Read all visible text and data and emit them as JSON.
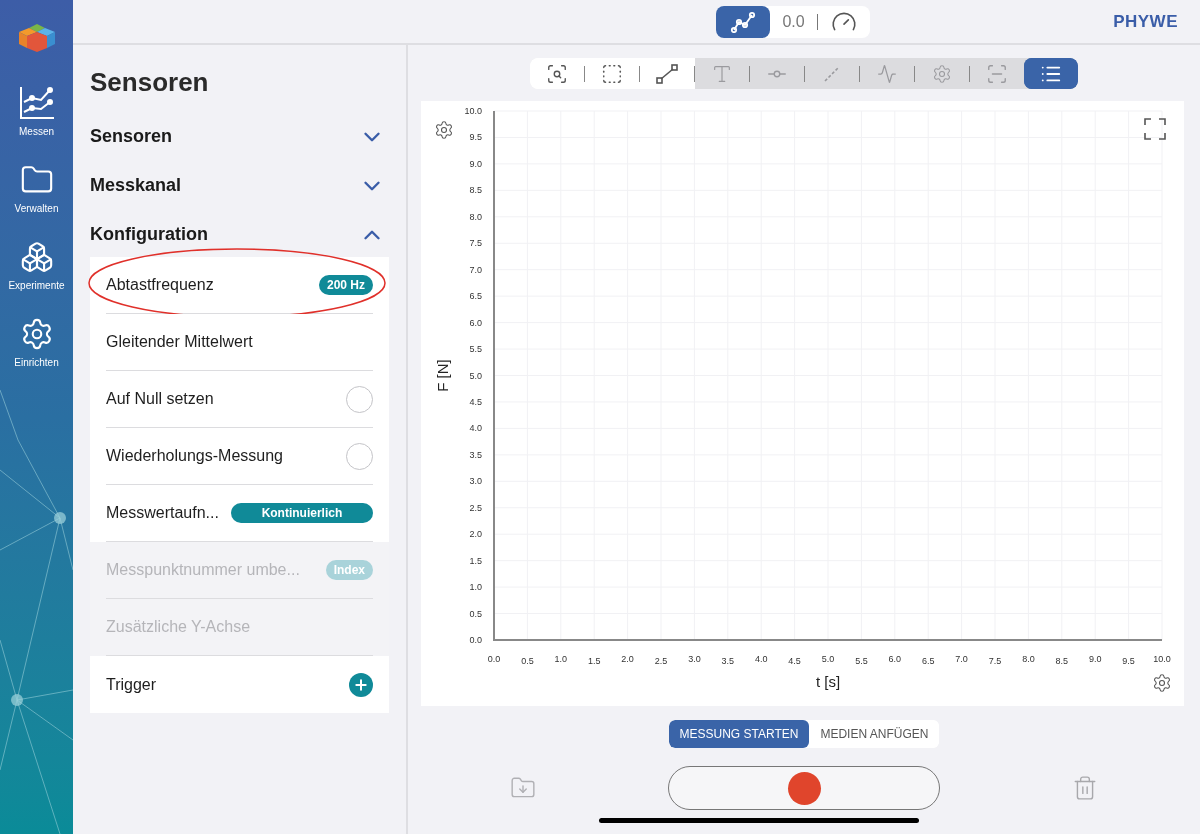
{
  "rail": {
    "items": [
      {
        "label": "Messen"
      },
      {
        "label": "Verwalten"
      },
      {
        "label": "Experimente"
      },
      {
        "label": "Einrichten"
      }
    ]
  },
  "display_modes": [
    {
      "selected": true
    },
    {
      "selected": false
    }
  ],
  "reading": "0.0",
  "brand": "PHYWE",
  "panel": {
    "title": "Sensoren",
    "sections": [
      {
        "label": "Sensoren",
        "expanded": false
      },
      {
        "label": "Messkanal",
        "expanded": false
      },
      {
        "label": "Konfiguration",
        "expanded": true,
        "items": [
          {
            "kind": "badge",
            "label": "Abtastfrequenz",
            "value": "200 Hz",
            "disabled": false,
            "circled": true
          },
          {
            "kind": "plain",
            "label": "Gleitender Mittelwert",
            "disabled": false,
            "circled": false
          },
          {
            "kind": "radio",
            "label": "Auf Null setzen",
            "checked": false,
            "disabled": false,
            "circled": false
          },
          {
            "kind": "radio",
            "label": "Wiederholungs-Messung",
            "checked": false,
            "disabled": false,
            "circled": false
          },
          {
            "kind": "wide-badge",
            "label": "Messwertaufn...",
            "value": "Kontinuierlich",
            "disabled": false,
            "circled": false
          },
          {
            "kind": "badge",
            "label": "Messpunktnummer umbe...",
            "value": "Index",
            "disabled": true,
            "circled": false
          },
          {
            "kind": "plain",
            "label": "Zusätzliche Y-Achse",
            "disabled": true,
            "circled": false
          },
          {
            "kind": "add",
            "label": "Trigger",
            "disabled": false,
            "circled": false
          }
        ]
      }
    ]
  },
  "toolbar": [
    {
      "disabled": false,
      "selected": false
    },
    {
      "disabled": false,
      "selected": false
    },
    {
      "disabled": false,
      "selected": false
    },
    {
      "disabled": true,
      "selected": false
    },
    {
      "disabled": true,
      "selected": false
    },
    {
      "disabled": true,
      "selected": false
    },
    {
      "disabled": true,
      "selected": false
    },
    {
      "disabled": true,
      "selected": false
    },
    {
      "disabled": true,
      "selected": false
    },
    {
      "disabled": false,
      "selected": true
    }
  ],
  "chart": {
    "chart_data": {
      "type": "line",
      "grid": true,
      "xlabel": "t [s]",
      "ylabel": "F [N]",
      "xlim": [
        0,
        10
      ],
      "ylim": [
        0,
        10
      ],
      "xticks": [
        {
          "value": 0,
          "label": "0.0"
        },
        {
          "value": 0.5,
          "label": "0.5"
        },
        {
          "value": 1,
          "label": "1.0"
        },
        {
          "value": 1.5,
          "label": "1.5"
        },
        {
          "value": 2,
          "label": "2.0"
        },
        {
          "value": 2.5,
          "label": "2.5"
        },
        {
          "value": 3,
          "label": "3.0"
        },
        {
          "value": 3.5,
          "label": "3.5"
        },
        {
          "value": 4,
          "label": "4.0"
        },
        {
          "value": 4.5,
          "label": "4.5"
        },
        {
          "value": 5,
          "label": "5.0"
        },
        {
          "value": 5.5,
          "label": "5.5"
        },
        {
          "value": 6,
          "label": "6.0"
        },
        {
          "value": 6.5,
          "label": "6.5"
        },
        {
          "value": 7,
          "label": "7.0"
        },
        {
          "value": 7.5,
          "label": "7.5"
        },
        {
          "value": 8,
          "label": "8.0"
        },
        {
          "value": 8.5,
          "label": "8.5"
        },
        {
          "value": 9,
          "label": "9.0"
        },
        {
          "value": 9.5,
          "label": "9.5"
        },
        {
          "value": 10,
          "label": "10.0"
        }
      ],
      "yticks": [
        {
          "value": 0,
          "label": "0.0"
        },
        {
          "value": 0.5,
          "label": "0.5"
        },
        {
          "value": 1,
          "label": "1.0"
        },
        {
          "value": 1.5,
          "label": "1.5"
        },
        {
          "value": 2,
          "label": "2.0"
        },
        {
          "value": 2.5,
          "label": "2.5"
        },
        {
          "value": 3,
          "label": "3.0"
        },
        {
          "value": 3.5,
          "label": "3.5"
        },
        {
          "value": 4,
          "label": "4.0"
        },
        {
          "value": 4.5,
          "label": "4.5"
        },
        {
          "value": 5,
          "label": "5.0"
        },
        {
          "value": 5.5,
          "label": "5.5"
        },
        {
          "value": 6,
          "label": "6.0"
        },
        {
          "value": 6.5,
          "label": "6.5"
        },
        {
          "value": 7,
          "label": "7.0"
        },
        {
          "value": 7.5,
          "label": "7.5"
        },
        {
          "value": 8,
          "label": "8.0"
        },
        {
          "value": 8.5,
          "label": "8.5"
        },
        {
          "value": 9,
          "label": "9.0"
        },
        {
          "value": 9.5,
          "label": "9.5"
        },
        {
          "value": 10,
          "label": "10.0"
        }
      ]
    }
  },
  "actions": [
    {
      "label": "MESSUNG STARTEN",
      "selected": true
    },
    {
      "label": "MEDIEN ANFÜGEN",
      "selected": false
    }
  ]
}
